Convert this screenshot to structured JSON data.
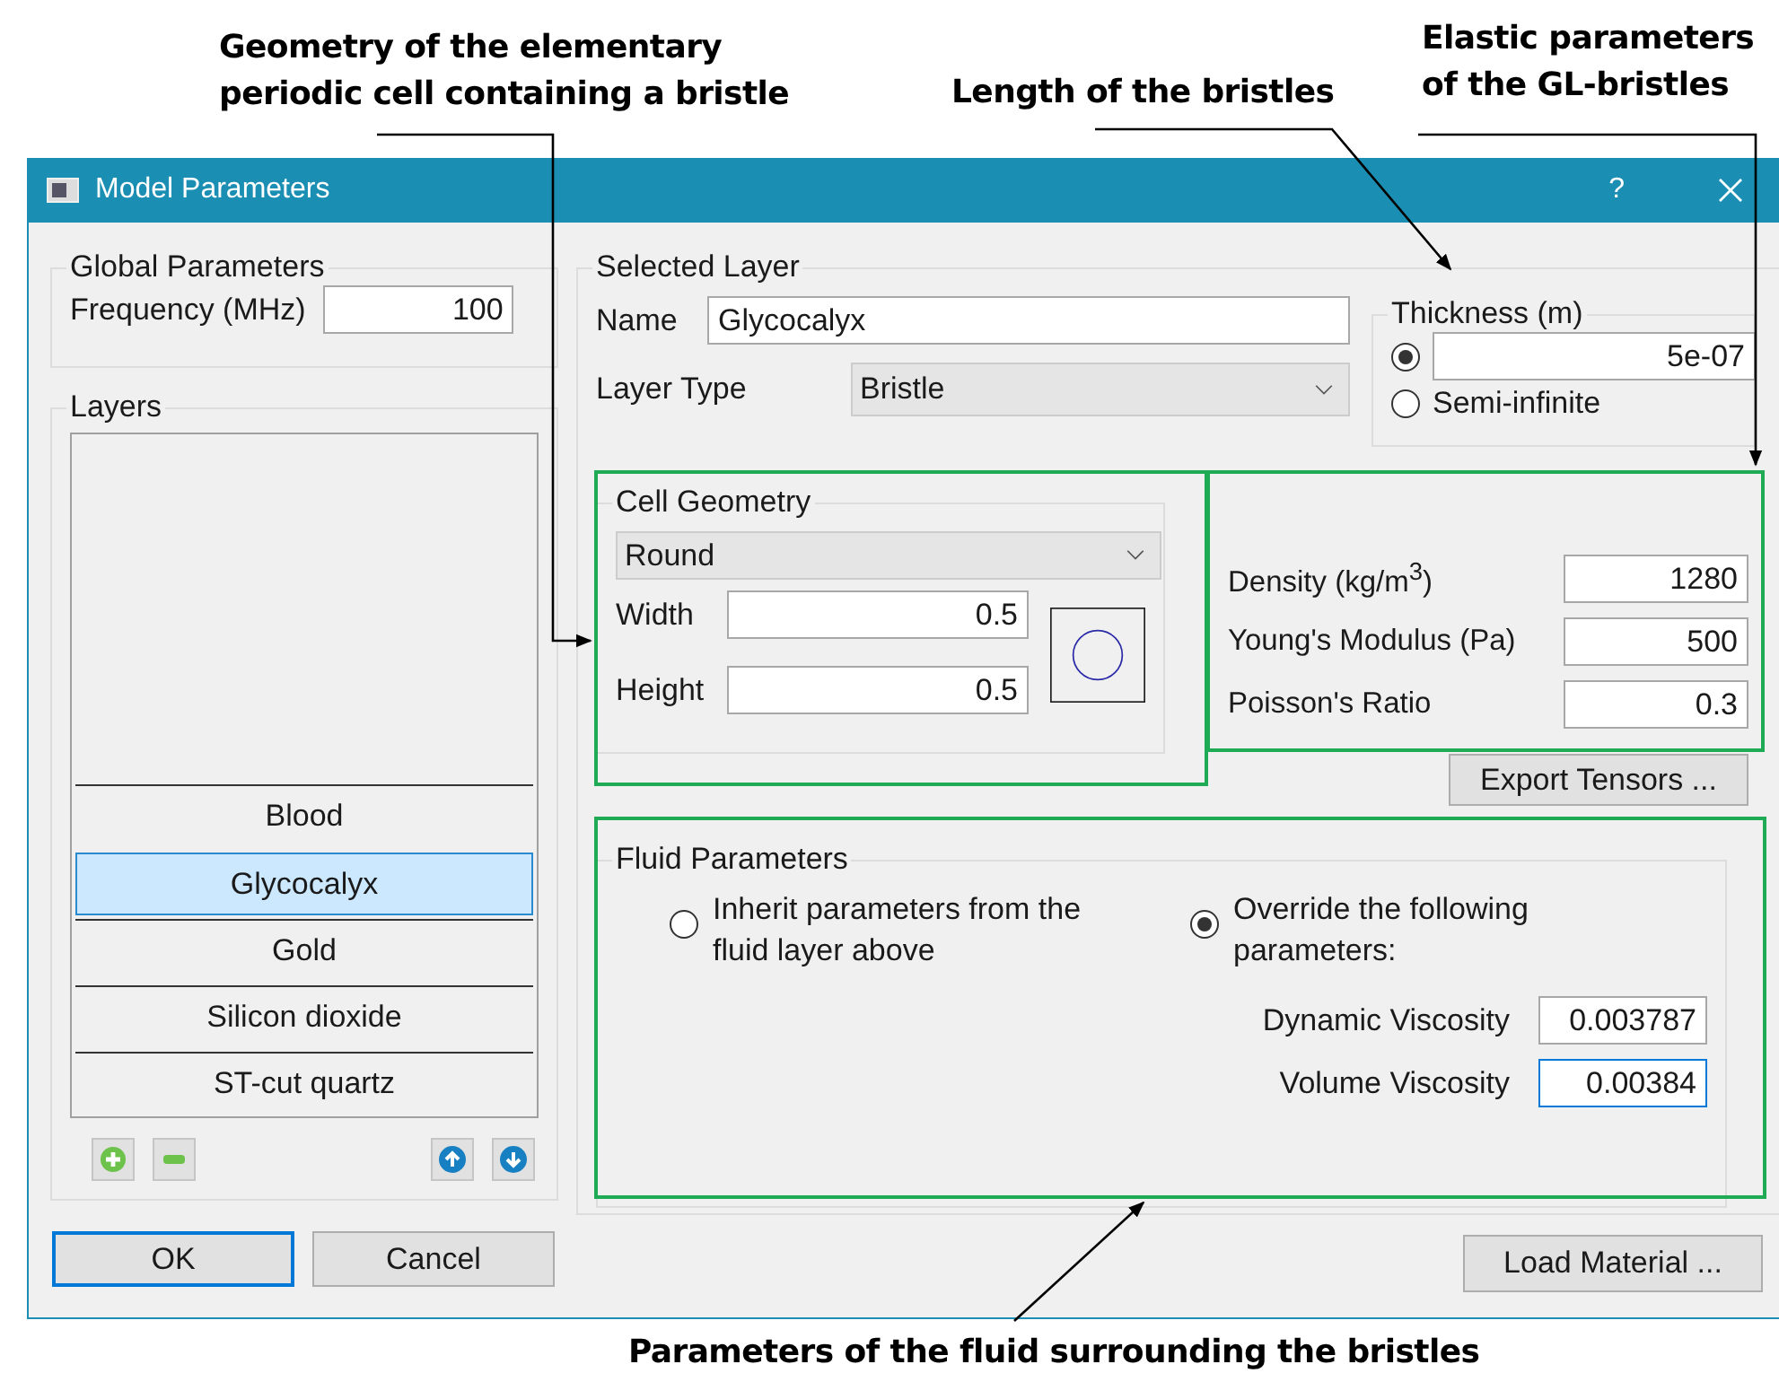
{
  "annotations": [
    {
      "text": "Geometry of the elementary periodic cell containing a bristle"
    },
    {
      "text": "Length of the bristles"
    },
    {
      "text": "Elastic parameters of the GL-bristles"
    },
    {
      "text": "Parameters of the fluid surrounding the bristles"
    }
  ],
  "window": {
    "title": "Model Parameters",
    "help": "?"
  },
  "global_parameters": {
    "title": "Global Parameters",
    "frequency_label": "Frequency (MHz)",
    "frequency_value": "100"
  },
  "layers": {
    "title": "Layers",
    "items": [
      {
        "label": "Blood",
        "selected": false
      },
      {
        "label": "Glycocalyx",
        "selected": true
      },
      {
        "label": "Gold",
        "selected": false
      },
      {
        "label": "Silicon dioxide",
        "selected": false
      },
      {
        "label": "ST-cut quartz",
        "selected": false
      }
    ]
  },
  "dialog_buttons": [
    {
      "label": "OK",
      "focused": true
    },
    {
      "label": "Cancel",
      "focused": false
    }
  ],
  "selected_layer": {
    "title": "Selected Layer",
    "name_label": "Name",
    "name_value": "Glycocalyx",
    "type_label": "Layer Type",
    "type_value": "Bristle"
  },
  "thickness": {
    "title": "Thickness (m)",
    "options": [
      {
        "kind": "field",
        "selected": true,
        "value": "5e-07"
      },
      {
        "kind": "label",
        "selected": false,
        "label": "Semi-infinite"
      }
    ]
  },
  "cell_geometry": {
    "title": "Cell Geometry",
    "shape": "Round",
    "fields": [
      {
        "label": "Width",
        "value": "0.5"
      },
      {
        "label": "Height",
        "value": "0.5"
      }
    ]
  },
  "elastic_parameters": [
    {
      "label": "Density (kg/m$^{3}$)",
      "value": "1280"
    },
    {
      "label": "Young's Modulus (Pa)",
      "value": "500"
    },
    {
      "label": "Poisson's Ratio",
      "value": "0.3"
    }
  ],
  "export_button": "Export Tensors ...",
  "fluid_parameters": {
    "title": "Fluid Parameters",
    "options": [
      {
        "label": "Inherit parameters from the fluid layer above",
        "selected": false
      },
      {
        "label": "Override the following parameters:",
        "selected": true
      }
    ],
    "fields": [
      {
        "label": "Dynamic Viscosity",
        "value": "0.003787",
        "focused": false
      },
      {
        "label": "Volume Viscosity",
        "value": "0.00384",
        "focused": true
      }
    ]
  },
  "load_button": "Load Material ..."
}
